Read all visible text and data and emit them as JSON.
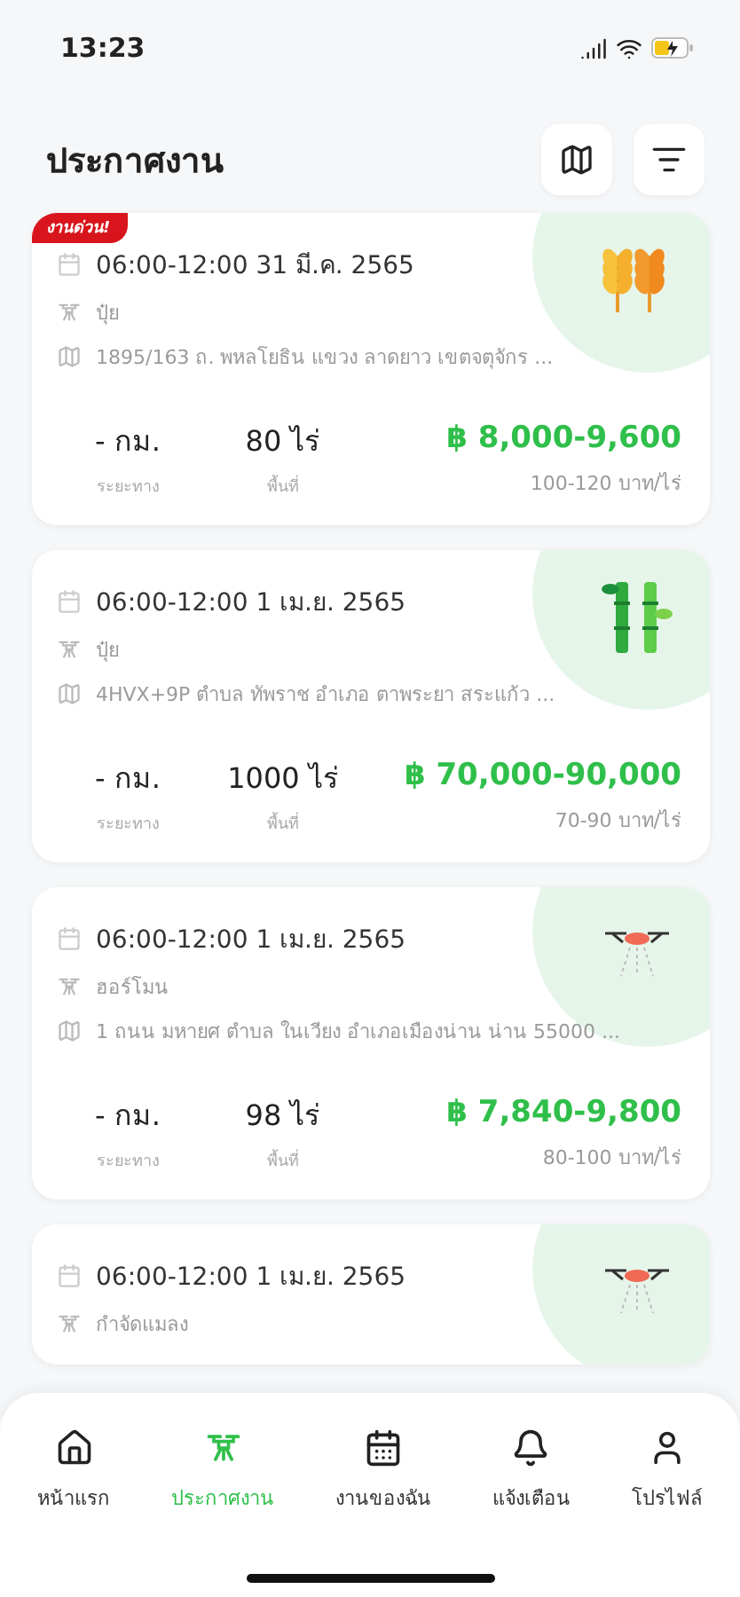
{
  "status_bar": {
    "time": "13:23"
  },
  "header": {
    "title": "ประกาศงาน"
  },
  "jobs": [
    {
      "urgent": true,
      "badge": "งานด่วน!",
      "kind": "wheat",
      "schedule": "06:00-12:00 31 มี.ค. 2565",
      "service": "ปุ๋ย",
      "address": "1895/163 ถ. พหลโยธิน แขวง ลาดยาว เขตจตุจักร ...",
      "distance": "- กม.",
      "distance_label": "ระยะทาง",
      "area": "80 ไร่",
      "area_label": "พื้นที่",
      "price": "฿ 8,000-9,600",
      "rate": "100-120 บาท/ไร่"
    },
    {
      "urgent": false,
      "kind": "bamboo",
      "schedule": "06:00-12:00 1 เม.ย. 2565",
      "service": "ปุ๋ย",
      "address": "4HVX+9P ตำบล ทัพราช อำเภอ ตาพระยา สระแก้ว ...",
      "distance": "- กม.",
      "distance_label": "ระยะทาง",
      "area": "1000 ไร่",
      "area_label": "พื้นที่",
      "price": "฿ 70,000-90,000",
      "rate": "70-90 บาท/ไร่"
    },
    {
      "urgent": false,
      "kind": "drone",
      "schedule": "06:00-12:00 1 เม.ย. 2565",
      "service": "ฮอร์โมน",
      "address": "1 ถนน มหายศ ตำบล ในเวียง อำเภอเมืองน่าน น่าน 55000 ...",
      "distance": "- กม.",
      "distance_label": "ระยะทาง",
      "area": "98 ไร่",
      "area_label": "พื้นที่",
      "price": "฿ 7,840-9,800",
      "rate": "80-100 บาท/ไร่"
    },
    {
      "urgent": false,
      "kind": "drone",
      "schedule": "06:00-12:00 1 เม.ย. 2565",
      "service": "กำจัดแมลง"
    }
  ],
  "nav": [
    {
      "kind": "home",
      "label": "หน้าแรก",
      "selected": false
    },
    {
      "kind": "drone",
      "label": "ประกาศงาน",
      "selected": true
    },
    {
      "kind": "calendar",
      "label": "งานของฉัน",
      "selected": false
    },
    {
      "kind": "bell",
      "label": "แจ้งเตือน",
      "selected": false
    },
    {
      "kind": "profile",
      "label": "โปรไฟล์",
      "selected": false
    }
  ]
}
